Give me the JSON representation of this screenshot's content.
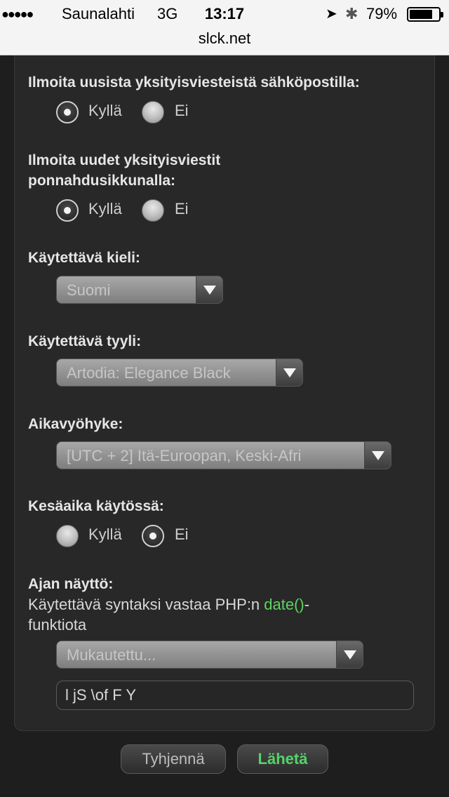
{
  "status_bar": {
    "signal": "●●●●●",
    "carrier": "Saunalahti",
    "network": "3G",
    "time": "13:17",
    "location_icon": "➤",
    "bluetooth_icon": "✱",
    "battery_percent": "79%",
    "battery_level": 0.79
  },
  "url_bar": {
    "url": "slck.net"
  },
  "settings": {
    "email_pm": {
      "label": "Ilmoita uusista yksityisviesteistä sähköpostilla:",
      "yes": "Kyllä",
      "no": "Ei",
      "selected": "yes"
    },
    "popup_pm": {
      "label_line1": "Ilmoita uudet yksityisviestit",
      "label_line2": "ponnahdusikkunalla:",
      "yes": "Kyllä",
      "no": "Ei",
      "selected": "yes"
    },
    "language": {
      "label": "Käytettävä kieli:",
      "value": "Suomi"
    },
    "style": {
      "label": "Käytettävä tyyli:",
      "value": "Artodia: Elegance Black"
    },
    "timezone": {
      "label": "Aikavyöhyke:",
      "value": "[UTC + 2] Itä-Euroopan, Keski-Afri"
    },
    "dst": {
      "label": "Kesäaika käytössä:",
      "yes": "Kyllä",
      "no": "Ei",
      "selected": "no"
    },
    "date_format": {
      "label": "Ajan näyttö:",
      "desc_prefix": "Käytettävä syntaksi vastaa PHP:n ",
      "desc_code": "date()",
      "desc_suffix": "-",
      "desc_line2": "funktiota",
      "select_value": "Mukautettu...",
      "input_value": "l jS \\of F Y"
    }
  },
  "buttons": {
    "reset": "Tyhjennä",
    "submit": "Lähetä"
  },
  "colors": {
    "accent_green": "#5fd35f",
    "background": "#1e1e1e",
    "panel": "#282828"
  }
}
